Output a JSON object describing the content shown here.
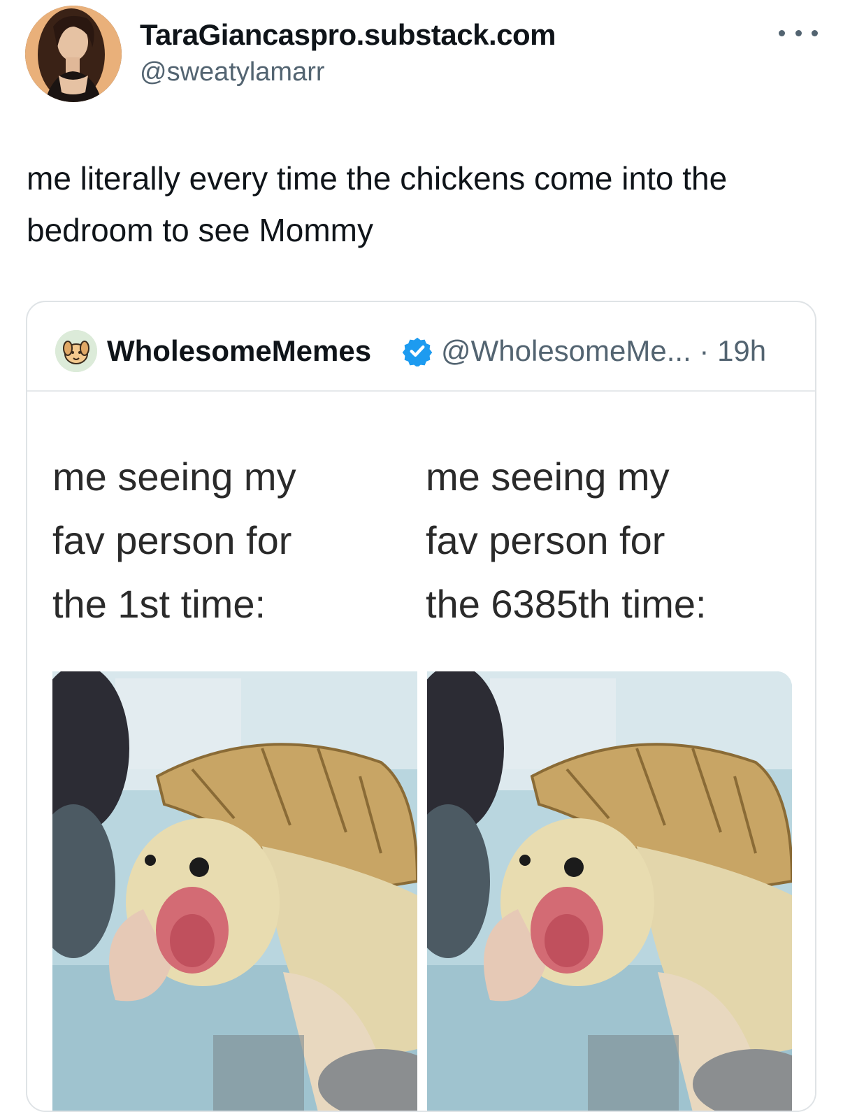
{
  "author": {
    "display_name": "TaraGiancaspro.substack.com",
    "handle": "@sweatylamarr",
    "avatar_icon": "profile-photo"
  },
  "more_icon": "more-horizontal-icon",
  "tweet": {
    "text": "me literally every time the chickens come into the bedroom to see Mommy"
  },
  "quoted_tweet": {
    "display_name": "WholesomeMemes",
    "verified_icon": "verified-badge-icon",
    "handle_time": "@WholesomeMe... · 19h",
    "accent_color": "#1d9bf0",
    "meme": {
      "left_caption": "me seeing my\nfav person for\nthe 1st time:",
      "right_caption": "me seeing my\nfav person for\nthe 6385th time:",
      "image_subject": "excited-turtle"
    }
  }
}
